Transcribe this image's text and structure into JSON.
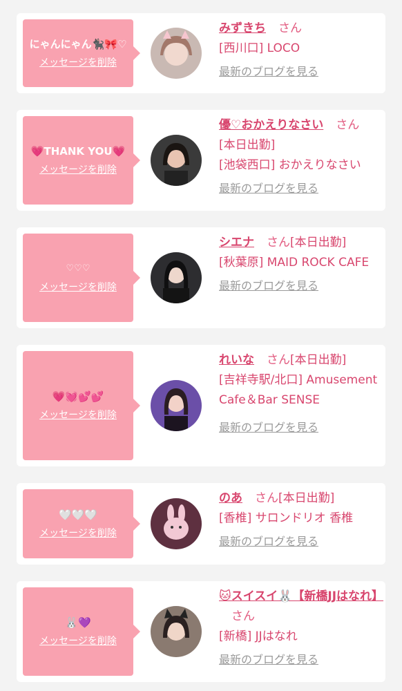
{
  "delete_label": "メッセージを削除",
  "san_label": "さん",
  "blog_label": "最新のブログを見る",
  "colors": {
    "bubble": "#f9a2b0",
    "accent": "#d8466e",
    "muted": "#9a9a9a"
  },
  "items": [
    {
      "message": "にゃんにゃん🐈‍⬛🎀♡",
      "name": "みずきち",
      "status": "",
      "shop": "[西川口] LOCO"
    },
    {
      "message": "💗THANK YOU💗",
      "name": "優♡おかえりなさい",
      "status": "[本日出勤]",
      "shop": "[池袋西口] おかえりなさい"
    },
    {
      "message": "♡♡♡",
      "name": "シエナ",
      "status": "[本日出勤]",
      "shop": "[秋葉原] MAID ROCK CAFE"
    },
    {
      "message": "💗💓💕💕",
      "name": "れいな",
      "status": "[本日出勤]",
      "shop": "[吉祥寺駅/北口] Amusement Cafe＆Bar SENSE"
    },
    {
      "message": "🤍🤍🤍",
      "name": "のあ",
      "status": "[本日出勤]",
      "shop": "[香椎] サロンドリオ 香椎"
    },
    {
      "message": "🐰💜",
      "name": "🐱スイスイ🐰【新橋JJはなれ】",
      "status": "",
      "shop": "[新橋] JJはなれ"
    }
  ]
}
